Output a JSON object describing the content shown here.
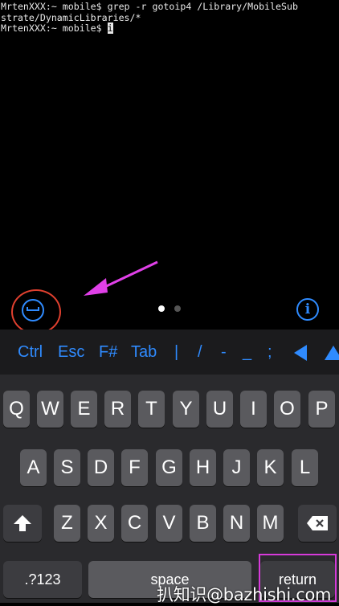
{
  "terminal": {
    "line1": "MrtenXXX:~ mobile$ grep -r gotoip4 /Library/MobileSub",
    "line2": "strate/DynamicLibraries/*",
    "line3_prompt": "MrtenXXX:~ mobile$ ",
    "line3_cursor": "i"
  },
  "toolbar": {
    "hide_keyboard_icon": "keyboard-hide-icon",
    "info_label": "i",
    "dots": 2,
    "active_dot": 0
  },
  "accessory": {
    "keys": [
      "Ctrl",
      "Esc",
      "F#",
      "Tab",
      "|",
      "/",
      "-",
      "_",
      ";"
    ],
    "left_arrow_icon": "triangle-left-icon",
    "up_arrow_icon": "triangle-up-icon"
  },
  "keyboard": {
    "row1": [
      "Q",
      "W",
      "E",
      "R",
      "T",
      "Y",
      "U",
      "I",
      "O",
      "P"
    ],
    "row2": [
      "A",
      "S",
      "D",
      "F",
      "G",
      "H",
      "J",
      "K",
      "L"
    ],
    "row3": [
      "Z",
      "X",
      "C",
      "V",
      "B",
      "N",
      "M"
    ],
    "shift_icon": "shift-arrow-icon",
    "delete_icon": "backspace-icon",
    "numbers_label": ".?123",
    "space_label": "space",
    "return_label": "return"
  },
  "watermark": "扒知识@bazhishi.com",
  "colors": {
    "accent": "#2f8bff",
    "annotation_red": "#e0402f",
    "annotation_magenta": "#d63ad9",
    "key_light": "#5a5a5e",
    "key_dark": "#3c3c40"
  }
}
